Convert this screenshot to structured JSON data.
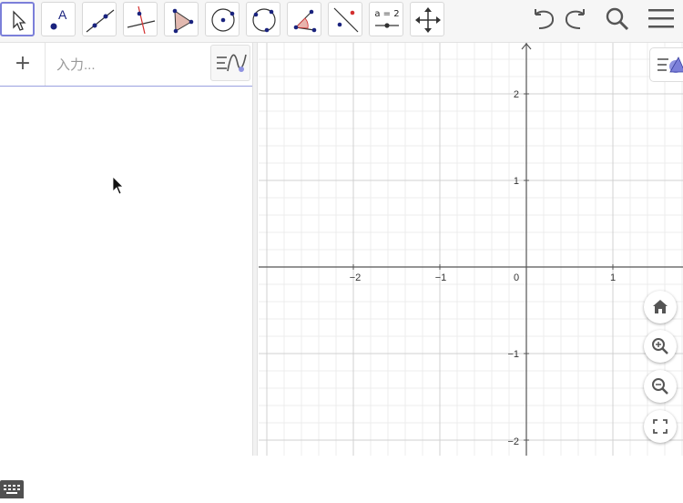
{
  "toolbar": {
    "tools": [
      {
        "name": "move-tool"
      },
      {
        "name": "point-tool"
      },
      {
        "name": "line-tool"
      },
      {
        "name": "perpendicular-line-tool"
      },
      {
        "name": "polygon-tool"
      },
      {
        "name": "circle-center-point-tool"
      },
      {
        "name": "circle-three-points-tool"
      },
      {
        "name": "angle-tool"
      },
      {
        "name": "reflect-tool"
      },
      {
        "name": "slider-tool",
        "label": "a = 2"
      },
      {
        "name": "move-graphics-view-tool"
      }
    ],
    "point_tool_label": "A"
  },
  "algebra": {
    "add_label": "+",
    "input_placeholder": "入力..."
  },
  "graphics": {
    "x_ticks": [
      "−2",
      "−1",
      "0",
      "1"
    ],
    "y_ticks": [
      "2",
      "1",
      "−1",
      "−2"
    ]
  },
  "colors": {
    "accent": "#7b7fd9",
    "point": "#1a237e",
    "grid_major": "#d0d0d0",
    "grid_minor": "#ececec"
  }
}
